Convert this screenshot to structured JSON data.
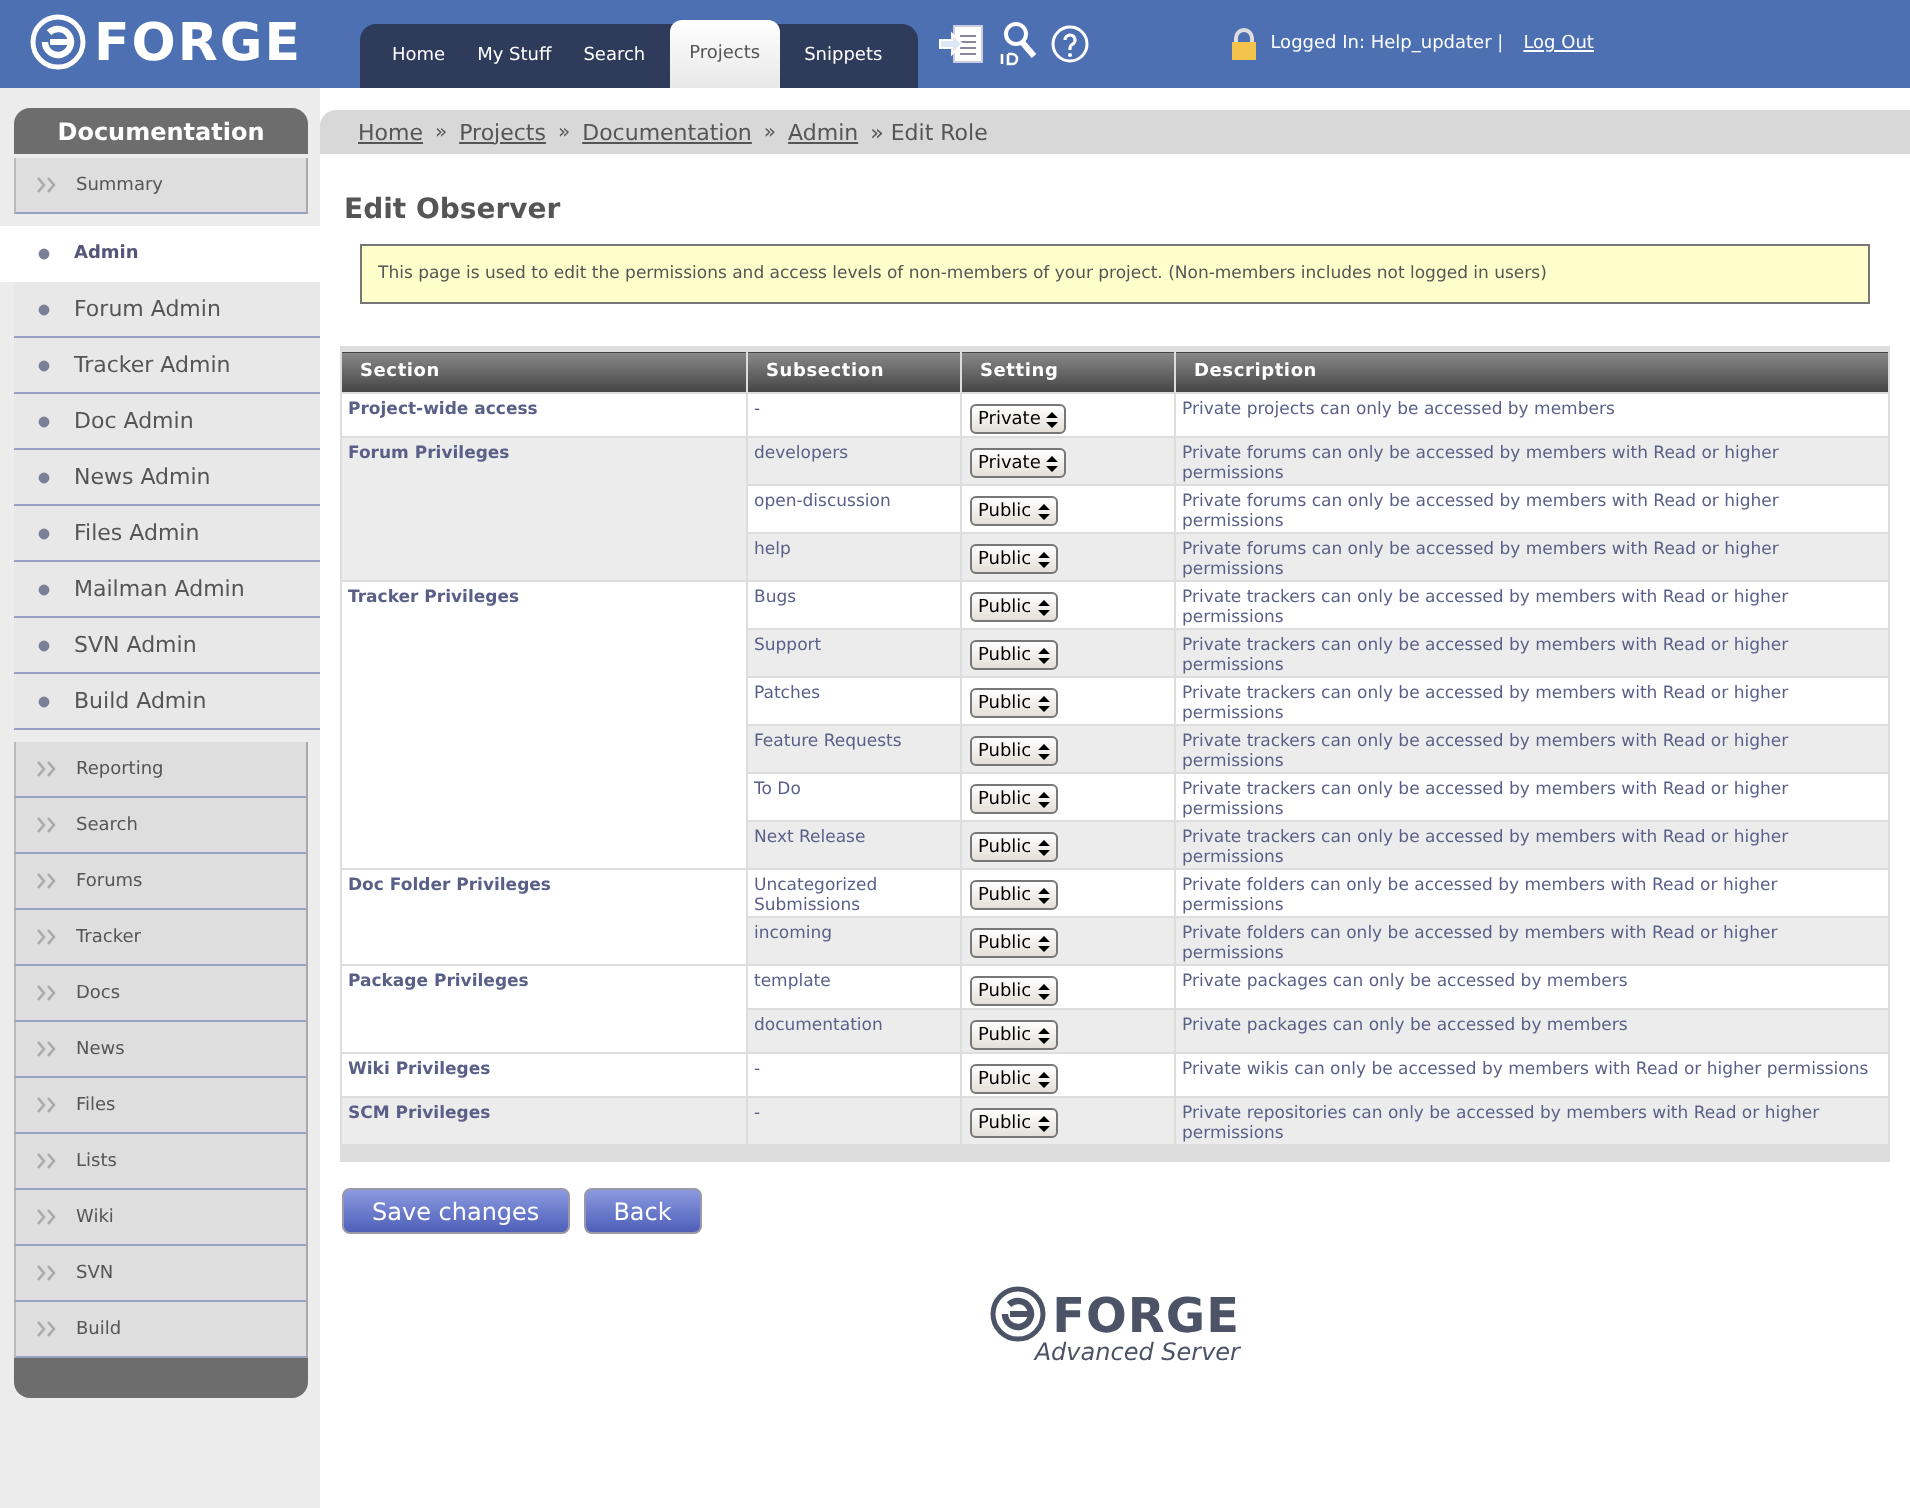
{
  "header": {
    "logo": "FORGE",
    "nav": [
      {
        "label": "Home",
        "selected": false
      },
      {
        "label": "My Stuff",
        "selected": false
      },
      {
        "label": "Search",
        "selected": false
      },
      {
        "label": "Projects",
        "selected": true
      },
      {
        "label": "Snippets",
        "selected": false
      }
    ],
    "user": "Logged In: Help_updater |",
    "logout": "Log Out"
  },
  "sidebar": {
    "title": "Documentation",
    "groups": [
      [
        {
          "label": "Summary",
          "kind": "link",
          "selected": false
        },
        {
          "label": "Admin",
          "kind": "sub",
          "selected": true
        },
        {
          "label": "Forum Admin",
          "kind": "sub",
          "selected": false
        },
        {
          "label": "Tracker Admin",
          "kind": "sub",
          "selected": false
        },
        {
          "label": "Doc Admin",
          "kind": "sub",
          "selected": false
        },
        {
          "label": "News Admin",
          "kind": "sub",
          "selected": false
        },
        {
          "label": "Files Admin",
          "kind": "sub",
          "selected": false
        },
        {
          "label": "Mailman Admin",
          "kind": "sub",
          "selected": false
        },
        {
          "label": "SVN Admin",
          "kind": "sub",
          "selected": false
        },
        {
          "label": "Build Admin",
          "kind": "sub",
          "selected": false
        }
      ],
      [
        {
          "label": "Reporting",
          "kind": "link",
          "selected": false
        },
        {
          "label": "Search",
          "kind": "link",
          "selected": false
        },
        {
          "label": "Forums",
          "kind": "link",
          "selected": false
        },
        {
          "label": "Tracker",
          "kind": "link",
          "selected": false
        },
        {
          "label": "Docs",
          "kind": "link",
          "selected": false
        },
        {
          "label": "News",
          "kind": "link",
          "selected": false
        },
        {
          "label": "Files",
          "kind": "link",
          "selected": false
        },
        {
          "label": "Lists",
          "kind": "link",
          "selected": false
        },
        {
          "label": "Wiki",
          "kind": "link",
          "selected": false
        },
        {
          "label": "SVN",
          "kind": "link",
          "selected": false
        },
        {
          "label": "Build",
          "kind": "link",
          "selected": false
        }
      ]
    ]
  },
  "breadcrumb": [
    {
      "label": "Home",
      "kind": "link"
    },
    {
      "label": "»",
      "kind": "sep"
    },
    {
      "label": "Projects",
      "kind": "link"
    },
    {
      "label": "»",
      "kind": "sep"
    },
    {
      "label": "Documentation",
      "kind": "link"
    },
    {
      "label": "»",
      "kind": "sep"
    },
    {
      "label": "Admin",
      "kind": "link"
    },
    {
      "label": "» Edit Role",
      "kind": "text"
    }
  ],
  "title": "Edit Observer",
  "note": "This page is used to edit the permissions and access levels of non-members of your project. (Non-members includes not logged in users)",
  "table": {
    "columns": [
      "Section",
      "Subsection",
      "Setting",
      "Description"
    ],
    "sections": [
      {
        "name": "Project-wide access",
        "rows": [
          {
            "subsection": "-",
            "setting": "Private",
            "description": "Private projects can only be accessed by members"
          }
        ]
      },
      {
        "name": "Forum Privileges",
        "rows": [
          {
            "subsection": "developers",
            "setting": "Private",
            "description": "Private forums can only be accessed by members with Read or higher permissions"
          },
          {
            "subsection": "open-discussion",
            "setting": "Public",
            "description": "Private forums can only be accessed by members with Read or higher permissions"
          },
          {
            "subsection": "help",
            "setting": "Public",
            "description": "Private forums can only be accessed by members with Read or higher permissions"
          }
        ]
      },
      {
        "name": "Tracker Privileges",
        "rows": [
          {
            "subsection": "Bugs",
            "setting": "Public",
            "description": "Private trackers can only be accessed by members with Read or higher permissions"
          },
          {
            "subsection": "Support",
            "setting": "Public",
            "description": "Private trackers can only be accessed by members with Read or higher permissions"
          },
          {
            "subsection": "Patches",
            "setting": "Public",
            "description": "Private trackers can only be accessed by members with Read or higher permissions"
          },
          {
            "subsection": "Feature Requests",
            "setting": "Public",
            "description": "Private trackers can only be accessed by members with Read or higher permissions"
          },
          {
            "subsection": "To Do",
            "setting": "Public",
            "description": "Private trackers can only be accessed by members with Read or higher permissions"
          },
          {
            "subsection": "Next Release",
            "setting": "Public",
            "description": "Private trackers can only be accessed by members with Read or higher permissions"
          }
        ]
      },
      {
        "name": "Doc Folder Privileges",
        "rows": [
          {
            "subsection": "Uncategorized Submissions",
            "setting": "Public",
            "description": "Private folders can only be accessed by members with Read or higher permissions"
          },
          {
            "subsection": "incoming",
            "setting": "Public",
            "description": "Private folders can only be accessed by members with Read or higher permissions"
          }
        ]
      },
      {
        "name": "Package Privileges",
        "rows": [
          {
            "subsection": "template",
            "setting": "Public",
            "description": "Private packages can only be accessed by members"
          },
          {
            "subsection": "documentation",
            "setting": "Public",
            "description": "Private packages can only be accessed by members"
          }
        ]
      },
      {
        "name": "Wiki Privileges",
        "rows": [
          {
            "subsection": "-",
            "setting": "Public",
            "description": "Private wikis can only be accessed by members with Read or higher permissions"
          }
        ]
      },
      {
        "name": "SCM Privileges",
        "rows": [
          {
            "subsection": "-",
            "setting": "Public",
            "description": "Private repositories can only be accessed by members with Read or higher permissions"
          }
        ]
      }
    ]
  },
  "buttons": [
    "Save changes",
    "Back"
  ],
  "footer": {
    "logo": "FORGE",
    "tagline": "Advanced Server"
  }
}
